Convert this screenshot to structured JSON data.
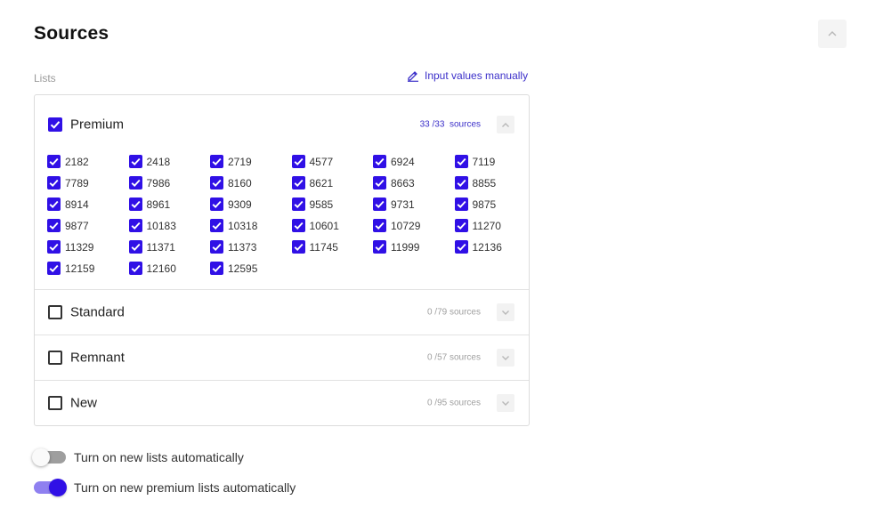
{
  "title": "Sources",
  "lists_label": "Lists",
  "manual_link": "Input values manually",
  "groups": [
    {
      "name": "Premium",
      "count": "33 /33  sources",
      "checked": true,
      "expanded": true
    },
    {
      "name": "Standard",
      "count": "0 /79 sources",
      "checked": false,
      "expanded": false
    },
    {
      "name": "Remnant",
      "count": "0 /57 sources",
      "checked": false,
      "expanded": false
    },
    {
      "name": "New",
      "count": "0 /95 sources",
      "checked": false,
      "expanded": false
    }
  ],
  "premium_sources": [
    "2182",
    "2418",
    "2719",
    "4577",
    "6924",
    "7119",
    "7789",
    "7986",
    "8160",
    "8621",
    "8663",
    "8855",
    "8914",
    "8961",
    "9309",
    "9585",
    "9731",
    "9875",
    "9877",
    "10183",
    "10318",
    "10601",
    "10729",
    "11270",
    "11329",
    "11371",
    "11373",
    "11745",
    "11999",
    "12136",
    "12159",
    "12160",
    "12595"
  ],
  "toggles": [
    {
      "label": "Turn on new lists automatically",
      "on": false
    },
    {
      "label": "Turn on new premium lists automatically",
      "on": true
    }
  ],
  "colors": {
    "accent": "#3010e6",
    "link": "#3b2fc9",
    "muted": "#a0a0a0"
  },
  "icons": {
    "collapse": "chevron-up-icon",
    "manual": "pencil-icon",
    "expand": "chevron-down-icon",
    "check": "checkmark-icon"
  }
}
